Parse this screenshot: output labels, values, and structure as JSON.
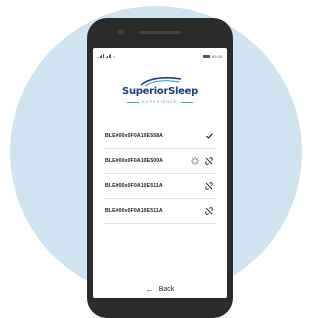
{
  "status_bar": {
    "time": "09:30"
  },
  "logo": {
    "text": "SuperiorSleep",
    "subtitle": "EXPERIENCE"
  },
  "devices": [
    {
      "name": "BLE#00x0F0A10E558A",
      "state": "connected"
    },
    {
      "name": "BLE#00x0F0A10E500A",
      "state": "connecting"
    },
    {
      "name": "BLE#00x0F0A10E511A",
      "state": "disconnected"
    },
    {
      "name": "BLE#00x0F0A10E511A",
      "state": "disconnected"
    }
  ],
  "footer": {
    "back_label": "Back"
  },
  "colors": {
    "background_circle": "#cfe3f0",
    "phone_body": "#2b2b2b",
    "logo_primary": "#1e3f77",
    "logo_accent": "#3aa2d6"
  },
  "icons": {
    "connected": "checkmark-icon",
    "connecting": "spinner-icon",
    "disconnected": "broken-link-icon",
    "back": "arrow-left-icon"
  }
}
